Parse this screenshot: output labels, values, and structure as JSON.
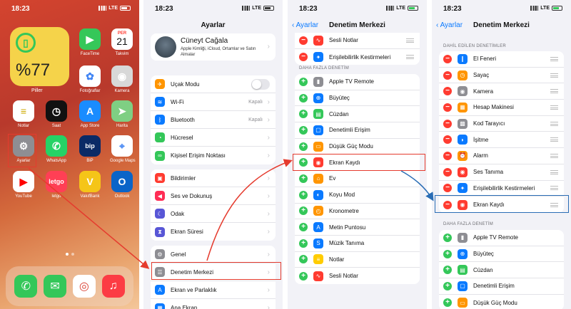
{
  "status": {
    "time": "18:23",
    "network": "LTE"
  },
  "home": {
    "battery_widget": {
      "percent": "%77",
      "label": "Piller"
    },
    "apps": [
      {
        "label": "FaceTime",
        "icon": "facetime-icon",
        "color": "#35c759"
      },
      {
        "label": "Takvim",
        "icon": "calendar-icon",
        "color": "#ffffff",
        "day": "PER",
        "date": "21"
      },
      {
        "label": "Fotoğraflar",
        "icon": "photos-icon",
        "color": "#ffffff"
      },
      {
        "label": "Kamera",
        "icon": "camera-icon",
        "color": "#d8d8d8"
      },
      {
        "label": "Notlar",
        "icon": "notes-icon",
        "color": "#ffffff"
      },
      {
        "label": "Saat",
        "icon": "clock-icon",
        "color": "#111111"
      },
      {
        "label": "App Store",
        "icon": "appstore-icon",
        "color": "#1a8cff"
      },
      {
        "label": "Harita",
        "icon": "maps-icon",
        "color": "#7fcf83"
      },
      {
        "label": "Ayarlar",
        "icon": "settings-icon",
        "color": "#8e8e93"
      },
      {
        "label": "WhatsApp",
        "icon": "whatsapp-icon",
        "color": "#25d366"
      },
      {
        "label": "BiP",
        "icon": "bip-icon",
        "color": "#0a2a66",
        "glyph": "bip"
      },
      {
        "label": "Google Maps",
        "icon": "googlemaps-icon",
        "color": "#ffffff"
      },
      {
        "label": "YouTube",
        "icon": "youtube-icon",
        "color": "#ffffff"
      },
      {
        "label": "letgo",
        "icon": "letgo-icon",
        "color": "#ff3f55",
        "glyph": "letgo"
      },
      {
        "label": "VakıfBank",
        "icon": "vakifbank-icon",
        "color": "#f5c518"
      },
      {
        "label": "Outlook",
        "icon": "outlook-icon",
        "color": "#0a64c8"
      }
    ],
    "dock": [
      {
        "icon": "phone-icon",
        "color": "#34c759"
      },
      {
        "icon": "messages-icon",
        "color": "#34c759"
      },
      {
        "icon": "chrome-icon",
        "color": "#ffffff"
      },
      {
        "icon": "music-icon",
        "color": "#fc3c44"
      }
    ]
  },
  "settings": {
    "title": "Ayarlar",
    "profile": {
      "name": "Cüneyt Cağala",
      "subtitle": "Apple Kimliği, iCloud, Ortamlar ve Satın Almalar"
    },
    "group1": [
      {
        "label": "Uçak Modu",
        "icon": "airplane-icon",
        "color": "#ff9500",
        "toggle": true
      },
      {
        "label": "Wi-Fi",
        "icon": "wifi-icon",
        "color": "#0a7aff",
        "value": "Kapalı"
      },
      {
        "label": "Bluetooth",
        "icon": "bluetooth-icon",
        "color": "#0a7aff",
        "value": "Kapalı"
      },
      {
        "label": "Hücresel",
        "icon": "cellular-icon",
        "color": "#34c759"
      },
      {
        "label": "Kişisel Erişim Noktası",
        "icon": "hotspot-icon",
        "color": "#34c759"
      }
    ],
    "group2": [
      {
        "label": "Bildirimler",
        "icon": "notifications-icon",
        "color": "#ff3b30"
      },
      {
        "label": "Ses ve Dokunuş",
        "icon": "sound-icon",
        "color": "#ff2d55"
      },
      {
        "label": "Odak",
        "icon": "focus-icon",
        "color": "#5856d6"
      },
      {
        "label": "Ekran Süresi",
        "icon": "screentime-icon",
        "color": "#5856d6"
      }
    ],
    "group3": [
      {
        "label": "Genel",
        "icon": "general-icon",
        "color": "#8e8e93"
      },
      {
        "label": "Denetim Merkezi",
        "icon": "controlcenter-icon",
        "color": "#8e8e93"
      },
      {
        "label": "Ekran ve Parlaklık",
        "icon": "display-icon",
        "color": "#0a7aff"
      },
      {
        "label": "Ana Ekran",
        "icon": "homescreen-icon",
        "color": "#0a7aff"
      }
    ]
  },
  "cc1": {
    "back": "Ayarlar",
    "title": "Denetim Merkezi",
    "top_rows": [
      {
        "label": "Sesli Notlar",
        "icon": "voicememo-icon",
        "color": "#ff3b30"
      },
      {
        "label": "Erişilebilirlik Kestirmeleri",
        "icon": "accessibility-icon",
        "color": "#0a7aff"
      }
    ],
    "section": "DAHA FAZLA DENETİM",
    "more": [
      {
        "label": "Apple TV Remote",
        "icon": "remote-icon",
        "color": "#8e8e93"
      },
      {
        "label": "Büyüteç",
        "icon": "magnifier-icon",
        "color": "#0a7aff"
      },
      {
        "label": "Cüzdan",
        "icon": "wallet-icon",
        "color": "#34c759"
      },
      {
        "label": "Denetimli Erişim",
        "icon": "guidedaccess-icon",
        "color": "#0a7aff"
      },
      {
        "label": "Düşük Güç Modu",
        "icon": "lowpower-icon",
        "color": "#ff9500"
      },
      {
        "label": "Ekran Kaydı",
        "icon": "record-icon",
        "color": "#ff3b30"
      },
      {
        "label": "Ev",
        "icon": "home-icon",
        "color": "#ff9500"
      },
      {
        "label": "Koyu Mod",
        "icon": "darkmode-icon",
        "color": "#0a7aff"
      },
      {
        "label": "Kronometre",
        "icon": "stopwatch-icon",
        "color": "#ff9500"
      },
      {
        "label": "Metin Puntosu",
        "icon": "textsize-icon",
        "color": "#0a7aff"
      },
      {
        "label": "Müzik Tanıma",
        "icon": "shazam-icon",
        "color": "#0a7aff"
      },
      {
        "label": "Notlar",
        "icon": "notes-icon",
        "color": "#ffcc00"
      },
      {
        "label": "Sesli Notlar",
        "icon": "voicememo-icon",
        "color": "#ff3b30"
      }
    ]
  },
  "cc2": {
    "back": "Ayarlar",
    "title": "Denetim Merkezi",
    "included_section": "DAHİL EDİLEN DENETİMLER",
    "included": [
      {
        "label": "El Feneri",
        "icon": "flashlight-icon",
        "color": "#0a7aff"
      },
      {
        "label": "Sayaç",
        "icon": "timer-icon",
        "color": "#ff9500"
      },
      {
        "label": "Kamera",
        "icon": "camera-icon",
        "color": "#8e8e93"
      },
      {
        "label": "Hesap Makinesi",
        "icon": "calculator-icon",
        "color": "#ff9500"
      },
      {
        "label": "Kod Tarayıcı",
        "icon": "qrcode-icon",
        "color": "#8e8e93"
      },
      {
        "label": "İşitme",
        "icon": "hearing-icon",
        "color": "#0a7aff"
      },
      {
        "label": "Alarm",
        "icon": "alarm-icon",
        "color": "#ff9500"
      },
      {
        "label": "Ses Tanıma",
        "icon": "soundrecognition-icon",
        "color": "#ff3b30"
      },
      {
        "label": "Erişilebilirlik Kestirmeleri",
        "icon": "accessibility-icon",
        "color": "#0a7aff"
      },
      {
        "label": "Ekran Kaydı",
        "icon": "record-icon",
        "color": "#ff3b30"
      }
    ],
    "more_section": "DAHA FAZLA DENETİM",
    "more": [
      {
        "label": "Apple TV Remote",
        "icon": "remote-icon",
        "color": "#8e8e93"
      },
      {
        "label": "Büyüteç",
        "icon": "magnifier-icon",
        "color": "#0a7aff"
      },
      {
        "label": "Cüzdan",
        "icon": "wallet-icon",
        "color": "#34c759"
      },
      {
        "label": "Denetimli Erişim",
        "icon": "guidedaccess-icon",
        "color": "#0a7aff"
      },
      {
        "label": "Düşük Güç Modu",
        "icon": "lowpower-icon",
        "color": "#ff9500"
      }
    ]
  }
}
